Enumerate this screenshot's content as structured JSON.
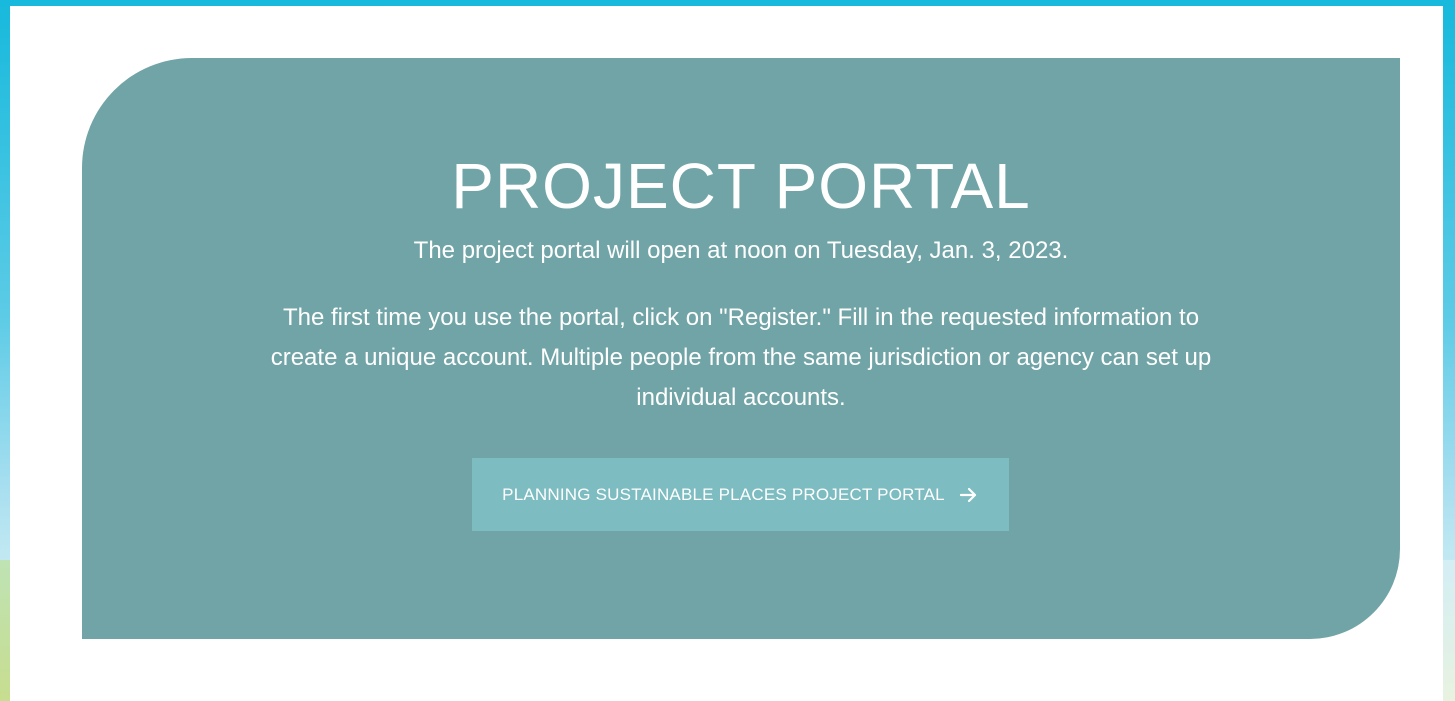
{
  "hero": {
    "title": "PROJECT PORTAL",
    "subtitle": "The project portal will open at noon on Tuesday, Jan. 3, 2023.",
    "body": "The first time you use the portal, click on \"Register.\" Fill in the requested information to create a unique account. Multiple people from the same jurisdiction or agency can set up individual accounts.",
    "button_label": "PLANNING SUSTAINABLE PLACES PROJECT PORTAL",
    "button_icon": "arrow-right-icon"
  },
  "colors": {
    "card_background": "#71a4a6",
    "button_background": "#7dbcc1",
    "text": "#ffffff",
    "frame": "#17b9dc"
  }
}
